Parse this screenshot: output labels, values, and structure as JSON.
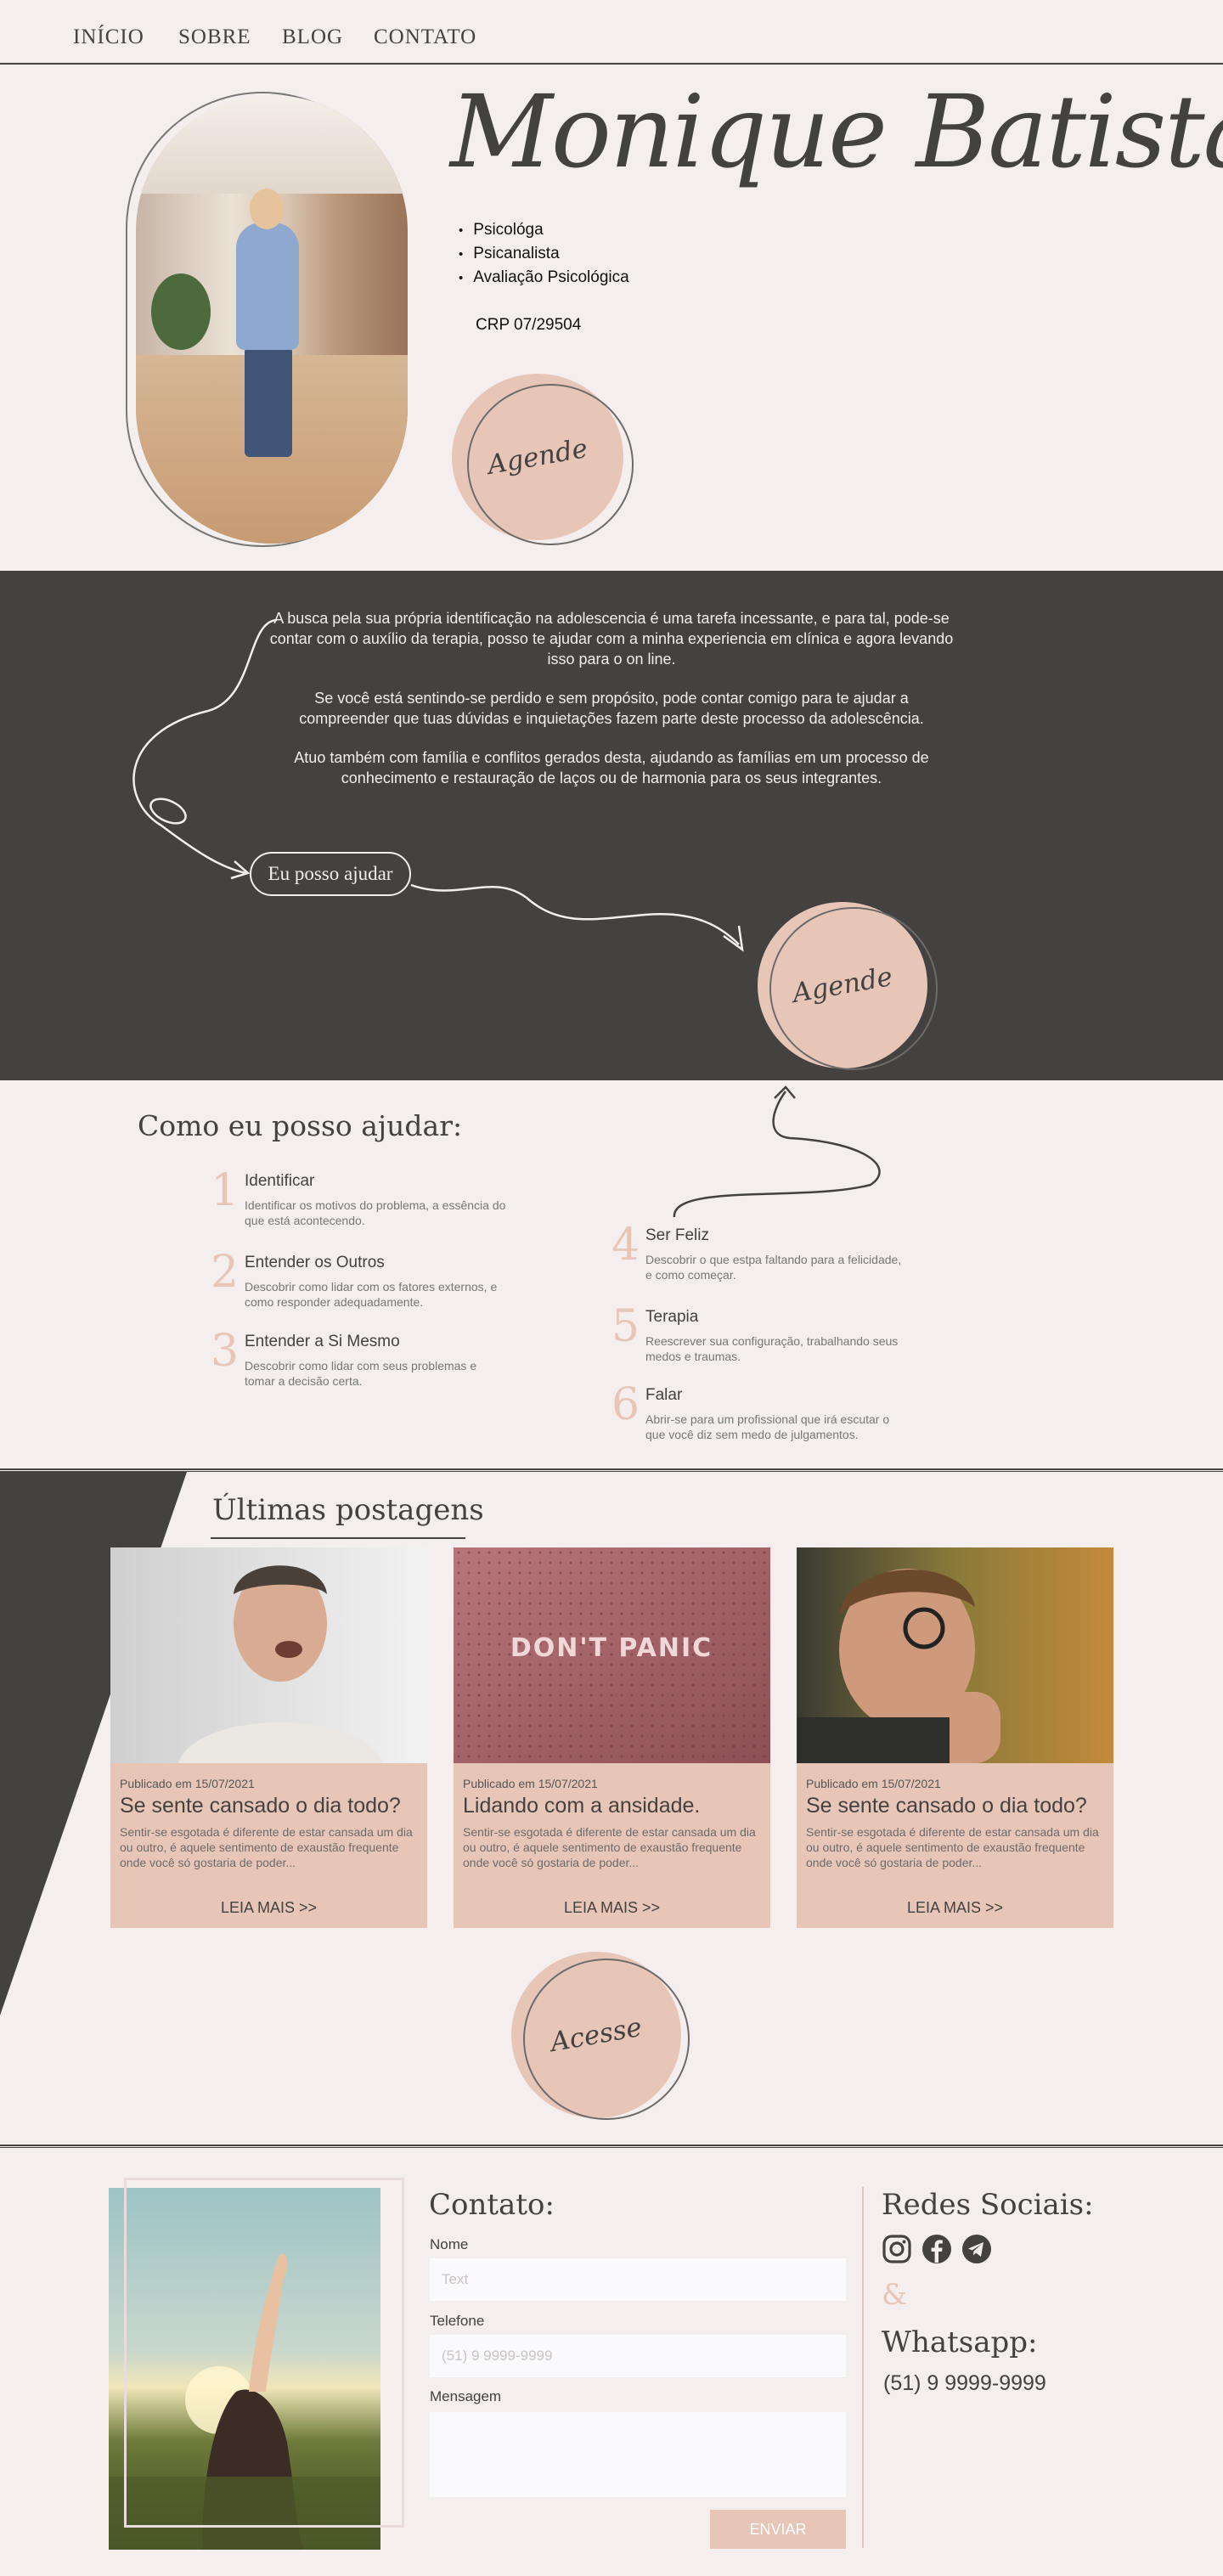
{
  "nav": {
    "items": [
      {
        "label": "INÍCIO"
      },
      {
        "label": "SOBRE"
      },
      {
        "label": "BLOG"
      },
      {
        "label": "CONTATO"
      }
    ]
  },
  "hero": {
    "name": "Monique Batista",
    "roles": [
      "Psicológa",
      "Psicanalista",
      "Avaliação Psicológica"
    ],
    "crp": "CRP 07/29504",
    "cta_label": "Agende"
  },
  "about": {
    "paragraphs": [
      "A busca pela sua própria identificação na adolescencia é uma tarefa incessante, e para tal, pode-se contar com o auxílio da terapia, posso te ajudar com a minha experiencia em clínica e agora levando isso para o on line.",
      "Se você está sentindo-se perdido e sem propósito, pode contar comigo para te ajudar a compreender que tuas dúvidas e inquietações fazem parte deste processo da adolescência.",
      "Atuo também com família e conflitos gerados desta, ajudando as famílias em um processo de conhecimento e restauração de laços ou de harmonia para os seus integrantes."
    ],
    "help_pill": "Eu posso ajudar",
    "cta_label": "Agende"
  },
  "help": {
    "title": "Como eu posso ajudar:",
    "steps": [
      {
        "num": "1",
        "title": "Identificar",
        "desc": "Identificar os motivos do problema, a essência do que está acontecendo."
      },
      {
        "num": "2",
        "title": "Entender os Outros",
        "desc": "Descobrir como lidar com os fatores externos, e como responder adequadamente."
      },
      {
        "num": "3",
        "title": "Entender a Si Mesmo",
        "desc": "Descobrir como lidar com seus problemas e tomar a decisão certa."
      },
      {
        "num": "4",
        "title": "Ser Feliz",
        "desc": "Descobrir o que estpa faltando para a felicidade, e como começar."
      },
      {
        "num": "5",
        "title": "Terapia",
        "desc": "Reescrever sua configuração, trabalhando seus medos e traumas."
      },
      {
        "num": "6",
        "title": "Falar",
        "desc": "Abrir-se para um profissional que irá escutar o que você diz sem medo de julgamentos."
      }
    ]
  },
  "posts": {
    "title": "Últimas postagens",
    "items": [
      {
        "date": "Publicado em 15/07/2021",
        "title": "Se sente cansado o dia todo?",
        "excerpt": "Sentir-se esgotada é diferente de estar cansada um dia ou outro, é aquele sentimento de exaustão frequente onde você só gostaria de poder...",
        "more": "LEIA MAIS >>"
      },
      {
        "date": "Publicado em 15/07/2021",
        "title": "Lidando com a ansidade.",
        "excerpt": "Sentir-se esgotada é diferente de estar cansada um dia ou outro, é aquele sentimento de exaustão frequente onde você só gostaria de poder...",
        "more": "LEIA MAIS >>",
        "image_text": "DON'T PANIC"
      },
      {
        "date": "Publicado em 15/07/2021",
        "title": "Se sente cansado o dia todo?",
        "excerpt": "Sentir-se esgotada é diferente de estar cansada um dia ou outro, é aquele sentimento de exaustão frequente onde você só gostaria de poder...",
        "more": "LEIA MAIS >>"
      }
    ],
    "cta_label": "Acesse"
  },
  "contact": {
    "title": "Contato:",
    "name_label": "Nome",
    "name_placeholder": "Text",
    "phone_label": "Telefone",
    "phone_placeholder": "(51) 9 9999-9999",
    "message_label": "Mensagem",
    "send_label": "ENVIAR",
    "social_title": "Redes Sociais:",
    "social_icons": [
      "instagram-icon",
      "facebook-icon",
      "telegram-icon"
    ],
    "ampersand": "&",
    "whatsapp_title": "Whatsapp:",
    "whatsapp_number": "(51) 9 9999-9999"
  },
  "colors": {
    "background": "#f5eeee",
    "dark": "#444141",
    "accent": "#e8c6b7"
  }
}
